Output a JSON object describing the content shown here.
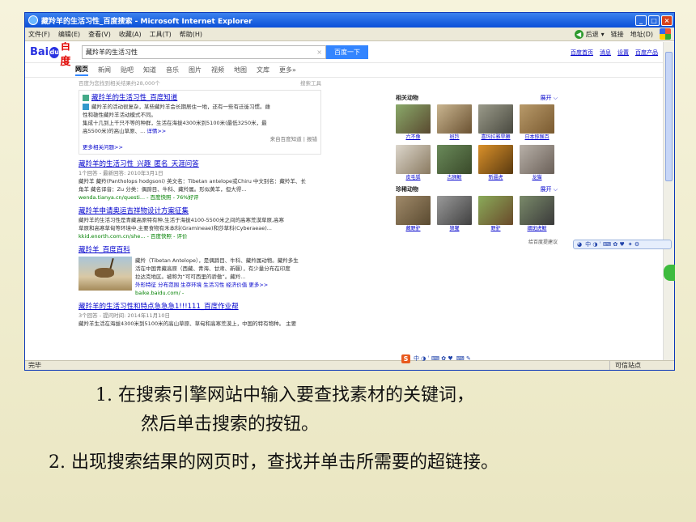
{
  "window": {
    "title": "藏羚羊的生活习性_百度搜索 - Microsoft Internet Explorer"
  },
  "menu": [
    "文件(F)",
    "编辑(E)",
    "查看(V)",
    "收藏(A)",
    "工具(T)",
    "帮助(H)"
  ],
  "toolbar": {
    "back": "后退",
    "links": "链接",
    "address": "地址(D)"
  },
  "search": {
    "query": "藏羚羊的生活习性",
    "button": "百度一下"
  },
  "toplinks": [
    "百度首页",
    "消息",
    "设置",
    "百度产品"
  ],
  "tabs": [
    "网页",
    "新闻",
    "贴吧",
    "知道",
    "音乐",
    "图片",
    "视频",
    "地图",
    "文库",
    "更多»"
  ],
  "results": {
    "count": "百度为您找到相关结果约28,000个",
    "tools": "搜索工具"
  },
  "r1": {
    "title": "藏羚羊的生活习性_百度知道",
    "d1": "藏羚羊的活动很复杂，某些藏羚羊会长期居住一地，还有一些有迁徙习惯。雌",
    "d2": "性和雄性藏羚羊活动模式不同。",
    "d3": "集成十几到上千只不等的种群，生活在海拔4300米到5100米(最低3250米，最",
    "d4": "高5500米)的高山草原、...",
    "details": "详情>>",
    "source": "来自百度知道 | 报错",
    "more": "更多相关问题>>"
  },
  "r2": {
    "title": "藏羚羊的生活习性_兴趣_匿名_天涯问答",
    "meta": "1个回答 - 最新回答: 2010年3月1日",
    "d1": "藏羚羊 藏羚(Pantholops hodgsoni) 英文名：Tibetan antelope或Chiru 中文别名：藏羚羊、长",
    "d2": "角羊 藏名译音：Zu 分类：偶蹄目、牛科、藏羚属。形似黄羊，但大得...",
    "url": "wenda.tianya.cn/questi... - 百度快照 - 76%好评"
  },
  "r3": {
    "title": "藏羚羊申请奥运吉祥物设计方案征集",
    "d1": "藏羚羊的生活习性是青藏高原特有种,生活于海拔4100-5500米之间的高寒荒漠草原,高寒",
    "d2": "草原和高寒草甸等环境中,主要食物有禾本科(Gramineae)和莎草科(Cyberaeae)...",
    "url": "kkid.enorth.com.cn/she... - 百度快照 - 评价"
  },
  "r4": {
    "title": "藏羚羊_百度百科",
    "d1": "藏羚（Tibetan Antelope），是偶蹄目、牛科、藏羚属动物。藏羚多生",
    "d2": "活在中国青藏高原（西藏、青海、甘肃、新疆），有少量分布在印度",
    "d3": "拉达克地区。被称为“可可西里的骄傲”。藏羚...",
    "links": "外形特征 分布范围 生存环境 生活习性 经济价值 更多>>",
    "url": "baike.baidu.com/ -"
  },
  "r5": {
    "title": "藏羚羊的生活习性和特点急急急1!!!111_百度作业帮",
    "meta": "3个回答 - 提问时间: 2014年11月10日",
    "d1": "藏羚羊生活在海拔4300米到5100米的高山草原、草甸和高寒荒漠上，中国的特有物种。 主要"
  },
  "side": {
    "h1": "相关动物",
    "h2": "珍稀动物",
    "expand": "展开 ⌵",
    "a": [
      "六不像",
      "斑羚",
      "喜玛拉雅旱獭",
      "日本猕猴百",
      "皮毛狐",
      "古狮鲸",
      "新疆虎",
      "龙猫"
    ],
    "b": [
      "藏野驴",
      "狼獾",
      "野驴",
      "细斑虎鲸"
    ],
    "feedback": "给百度提建议"
  },
  "status": {
    "left": "完毕",
    "zone": "可信站点"
  },
  "ime": {
    "label": "中 ◑ ʿ ⌨ ✿ ♥"
  },
  "slide": {
    "line1": "1. 在搜索引擎网站中输入要查找素材的关键词，",
    "line1b": "然后单击搜索的按钮。",
    "line2": "2. 出现搜索结果的网页时，查找并单击所需要的超链接。"
  }
}
